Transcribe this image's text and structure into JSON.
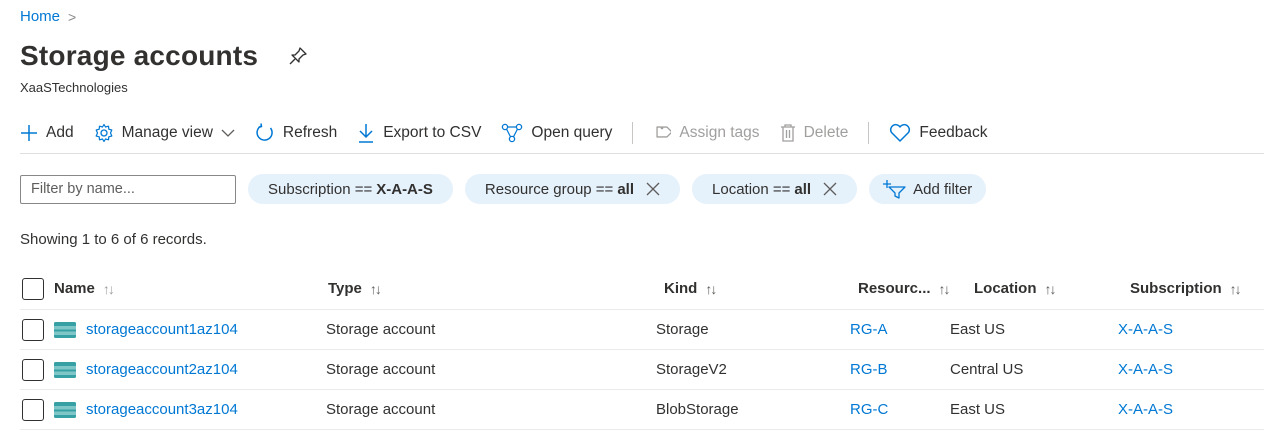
{
  "breadcrumb": {
    "home": "Home",
    "separator": ">"
  },
  "page": {
    "title": "Storage accounts",
    "subtitle": "XaaSTechnologies"
  },
  "toolbar": {
    "add": "Add",
    "manage_view": "Manage view",
    "refresh": "Refresh",
    "export_csv": "Export to CSV",
    "open_query": "Open query",
    "assign_tags": "Assign tags",
    "delete": "Delete",
    "feedback": "Feedback"
  },
  "filters": {
    "name_placeholder": "Filter by name...",
    "subscription_label": "Subscription ==",
    "subscription_value": "X-A-A-S",
    "resource_group_label": "Resource group ==",
    "resource_group_value": "all",
    "location_label": "Location ==",
    "location_value": "all",
    "add_filter": "Add filter"
  },
  "records_text": "Showing 1 to 6 of 6 records.",
  "table": {
    "columns": {
      "name": "Name",
      "type": "Type",
      "kind": "Kind",
      "resource_group": "Resourc...",
      "location": "Location",
      "subscription": "Subscription"
    },
    "sort_glyph": "↑↓",
    "rows": [
      {
        "name": "storageaccount1az104",
        "type": "Storage account",
        "kind": "Storage",
        "resource_group": "RG-A",
        "location": "East US",
        "subscription": "X-A-A-S"
      },
      {
        "name": "storageaccount2az104",
        "type": "Storage account",
        "kind": "StorageV2",
        "resource_group": "RG-B",
        "location": "Central US",
        "subscription": "X-A-A-S"
      },
      {
        "name": "storageaccount3az104",
        "type": "Storage account",
        "kind": "BlobStorage",
        "resource_group": "RG-C",
        "location": "East US",
        "subscription": "X-A-A-S"
      }
    ]
  },
  "colors": {
    "accent": "#0078d4",
    "pill_bg": "#e5f1fb",
    "text": "#323130",
    "disabled": "#a19f9d"
  },
  "icons": [
    "chevron-right-icon",
    "pin-icon",
    "plus-icon",
    "gear-icon",
    "chevron-down-icon",
    "refresh-icon",
    "download-icon",
    "query-icon",
    "tag-icon",
    "trash-icon",
    "heart-icon",
    "close-icon",
    "add-filter-icon",
    "storage-account-icon"
  ]
}
